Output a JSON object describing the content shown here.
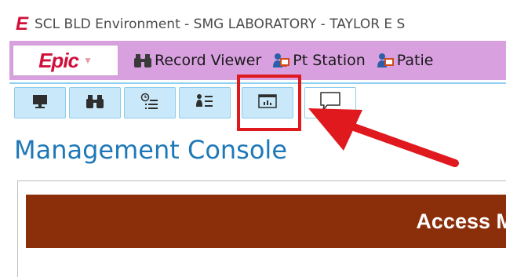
{
  "window": {
    "app_letter": "E",
    "title": "SCL BLD Environment - SMG LABORATORY - TAYLOR E S"
  },
  "menubar": {
    "epic_label": "Epic",
    "items": [
      {
        "label": "Record Viewer",
        "icon": "binoculars-icon"
      },
      {
        "label": "Pt Station",
        "icon": "patient-station-icon"
      },
      {
        "label": "Patie",
        "icon": "patient-icon"
      }
    ]
  },
  "tabs": [
    {
      "name": "monitor",
      "icon": "monitor-icon"
    },
    {
      "name": "binoculars",
      "icon": "binoculars-icon"
    },
    {
      "name": "clock-list",
      "icon": "clock-list-icon"
    },
    {
      "name": "person-list",
      "icon": "person-list-icon"
    },
    {
      "name": "dashboard",
      "icon": "dashboard-icon"
    },
    {
      "name": "chat",
      "icon": "chat-bubble-icon"
    }
  ],
  "content": {
    "title": "Management Console",
    "panel_header": "Access M"
  },
  "colors": {
    "menubar_bg": "#d9a0e0",
    "epic_red": "#d0103a",
    "tab_bg": "#c9e9fa",
    "title_blue": "#1e78b8",
    "header_bg": "#8b2e0a",
    "annotation_red": "#e0191f"
  }
}
